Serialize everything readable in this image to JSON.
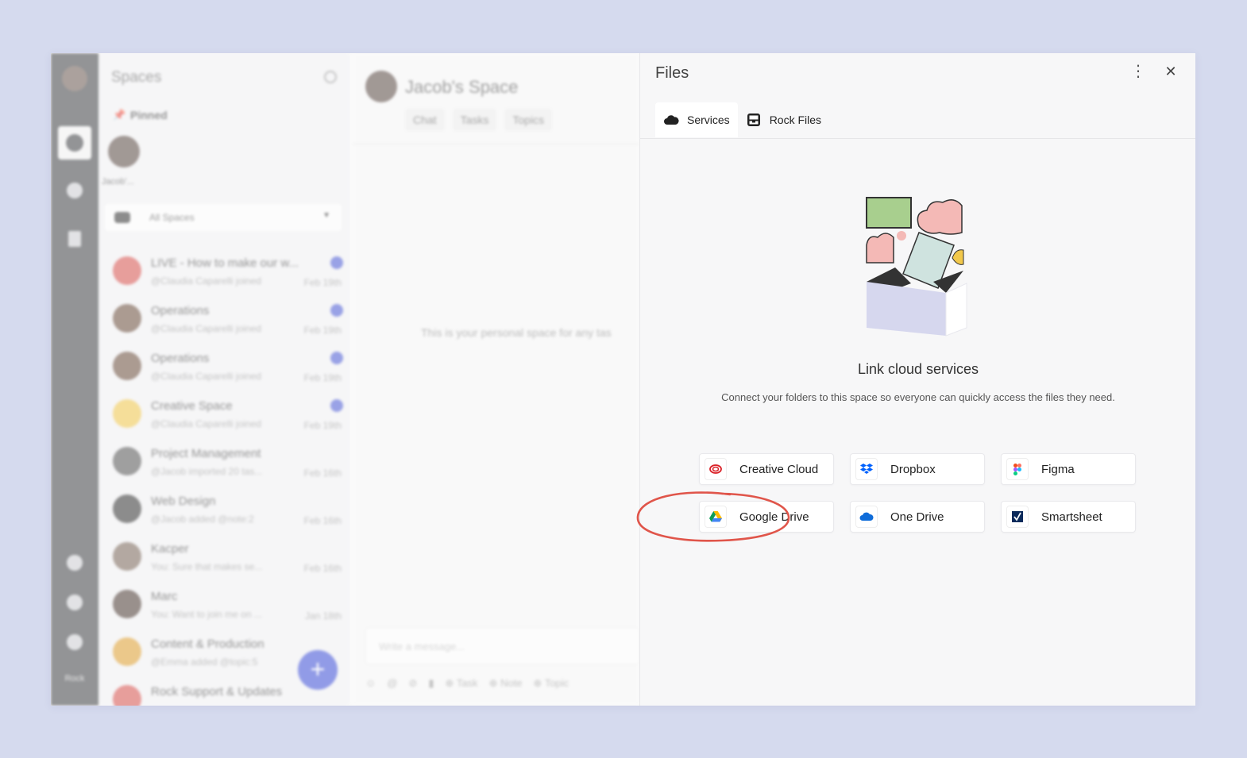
{
  "sidebar": {
    "title": "Spaces",
    "pinned_label": "Pinned",
    "pinned_name": "Jacob'...",
    "filter_label": "All Spaces",
    "rail_label": "Rock",
    "items": [
      {
        "name": "LIVE - How to make our w...",
        "sub": "@Claudia Caparelli joined",
        "date": "Feb 19th",
        "color": "#d9534f"
      },
      {
        "name": "Operations",
        "sub": "@Claudia Caparelli joined",
        "date": "Feb 19th",
        "color": "#6b4e3d"
      },
      {
        "name": "Operations",
        "sub": "@Claudia Caparelli joined",
        "date": "Feb 19th",
        "color": "#6b4e3d"
      },
      {
        "name": "Creative Space",
        "sub": "@Claudia Caparelli joined",
        "date": "Feb 19th",
        "color": "#f2c84b"
      },
      {
        "name": "Project Management",
        "sub": "@Jacob imported 20 tas...",
        "date": "Feb 16th",
        "color": "#555555"
      },
      {
        "name": "Web Design",
        "sub": "@Jacob added @note:2",
        "date": "Feb 16th",
        "color": "#333333"
      },
      {
        "name": "Kacper",
        "sub": "You: Sure that makes se...",
        "date": "Feb 16th",
        "color": "#7a6659"
      },
      {
        "name": "Marc",
        "sub": "You: Want to join me on ...",
        "date": "Jan 18th",
        "color": "#4b3a33"
      },
      {
        "name": "Content & Production",
        "sub": "@Emma added @topic:5",
        "date": "",
        "color": "#e0a030"
      },
      {
        "name": "Rock Support & Updates",
        "sub": "",
        "date": "",
        "color": "#d9534f"
      }
    ]
  },
  "chat": {
    "title": "Jacob's Space",
    "tabs": [
      "Chat",
      "Tasks",
      "Topics"
    ],
    "empty_text": "This is your personal space for any tas",
    "input_placeholder": "Write a message...",
    "tools": [
      "Task",
      "Note",
      "Topic"
    ]
  },
  "files": {
    "title": "Files",
    "tabs": {
      "services": "Services",
      "rock_files": "Rock Files"
    },
    "heading": "Link cloud services",
    "description": "Connect your folders to this space so everyone can quickly access the files they need.",
    "services": {
      "creative_cloud": "Creative Cloud",
      "dropbox": "Dropbox",
      "figma": "Figma",
      "google_drive": "Google Drive",
      "one_drive": "One Drive",
      "smartsheet": "Smartsheet"
    }
  },
  "colors": {
    "background": "#d5daee",
    "rail": "#3f4145",
    "accent": "#3d4fd8",
    "annotation": "#e0554a"
  }
}
